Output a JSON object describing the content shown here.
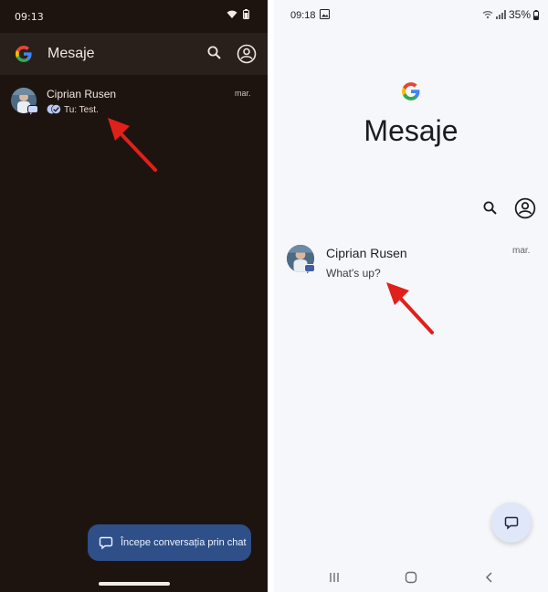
{
  "left_phone": {
    "status": {
      "time": "09:13"
    },
    "appbar": {
      "title": "Mesaje"
    },
    "conversation": {
      "name": "Ciprian Rusen",
      "snippet": "Tu: Test.",
      "date": "mar."
    },
    "fab": {
      "label": "Începe conversația prin chat"
    }
  },
  "right_phone": {
    "status": {
      "time": "09:18",
      "battery": "35%"
    },
    "title": "Mesaje",
    "conversation": {
      "name": "Ciprian Rusen",
      "snippet": "What's up?",
      "date": "mar."
    }
  },
  "colors": {
    "dark_bg": "#1e140f",
    "dark_appbar": "#2a201b",
    "light_bg": "#f6f7fb",
    "fab_dark": "#2e4f88",
    "fab_light": "#dfe7f8",
    "arrow": "#e0201a"
  }
}
